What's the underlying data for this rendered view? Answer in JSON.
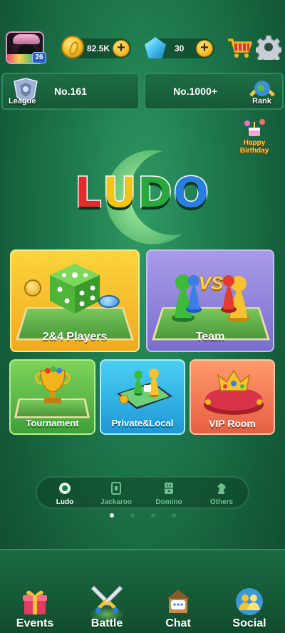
{
  "profile": {
    "level": "26"
  },
  "currency": {
    "coins": "82.5K",
    "gems": "30",
    "plus": "+"
  },
  "rankbar": {
    "league_label": "League",
    "league_value": "No.161",
    "rank_label": "Rank",
    "rank_value": "No.1000+"
  },
  "event": {
    "birthday_line1": "Happy",
    "birthday_line2": "Birthday"
  },
  "logo": {
    "l1": "L",
    "l2": "U",
    "l3": "D",
    "l4": "O",
    "colors": [
      "#e22b2b",
      "#f2c418",
      "#2aa83e",
      "#2a7ee0"
    ]
  },
  "games": {
    "players": "2&4 Players",
    "team": "Team",
    "vs": "VS",
    "tournament": "Tournament",
    "private": "Private&Local",
    "vip": "VIP Room"
  },
  "modes": [
    {
      "label": "Ludo",
      "icon": "ludo-icon",
      "active": true
    },
    {
      "label": "Jackaroo",
      "icon": "jackaroo-icon",
      "active": false
    },
    {
      "label": "Domino",
      "icon": "domino-icon",
      "active": false
    },
    {
      "label": "Others",
      "icon": "others-icon",
      "active": false
    }
  ],
  "pager": {
    "count": 4,
    "current": 1
  },
  "nav": [
    {
      "label": "Events",
      "icon": "gift-icon"
    },
    {
      "label": "Battle",
      "icon": "swords-icon",
      "active": true
    },
    {
      "label": "Chat",
      "icon": "chat-icon"
    },
    {
      "label": "Social",
      "icon": "friends-icon"
    }
  ]
}
